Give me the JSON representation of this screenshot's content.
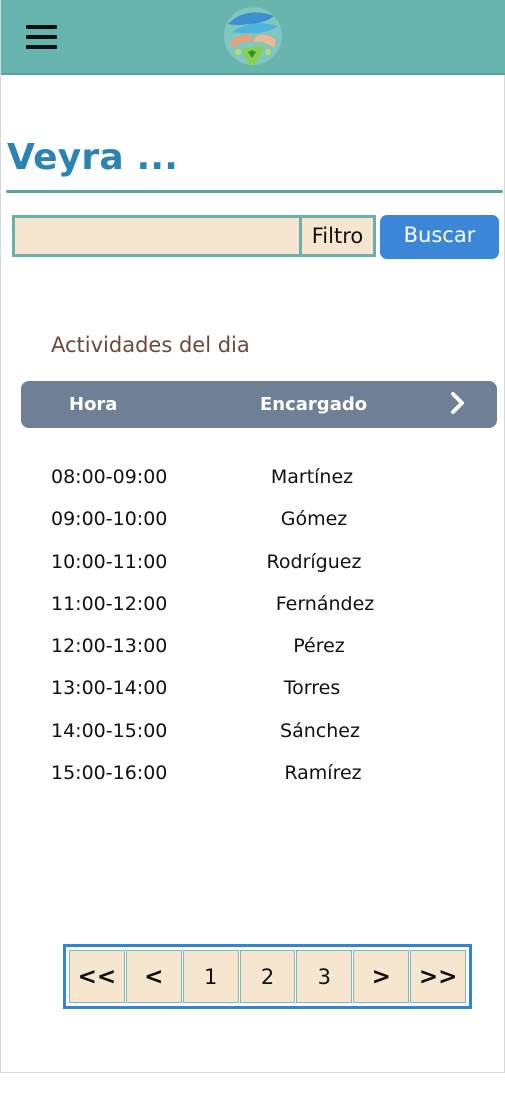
{
  "header": {
    "menu_icon": "hamburger-menu-icon",
    "logo_icon": "hands-heart-logo-icon"
  },
  "page": {
    "title": "Veyra ..."
  },
  "search": {
    "value": "",
    "filter_label": "Filtro",
    "button_label": "Buscar"
  },
  "activities": {
    "section_title": "Actividades del dia",
    "columns": {
      "time": "Hora",
      "person": "Encargado",
      "next_icon": "chevron-right-icon"
    },
    "rows": [
      {
        "time": "08:00-09:00",
        "person": "Martínez"
      },
      {
        "time": "09:00-10:00",
        "person": "Gómez"
      },
      {
        "time": "10:00-11:00",
        "person": "Rodríguez"
      },
      {
        "time": "11:00-12:00",
        "person": "Fernández"
      },
      {
        "time": "12:00-13:00",
        "person": "Pérez"
      },
      {
        "time": "13:00-14:00",
        "person": "Torres"
      },
      {
        "time": "14:00-15:00",
        "person": "Sánchez"
      },
      {
        "time": "15:00-16:00",
        "person": "Ramírez"
      }
    ]
  },
  "pagination": {
    "first": "<<",
    "prev": "<",
    "pages": [
      "1",
      "2",
      "3"
    ],
    "next": ">",
    "last": ">>"
  },
  "colors": {
    "header_bg": "#68b4ae",
    "title": "#2a83b2",
    "input_bg": "#f7e6cf",
    "button_bg": "#3b86d6",
    "table_header_bg": "#6e7f96",
    "pager_border": "#2f86d9"
  }
}
